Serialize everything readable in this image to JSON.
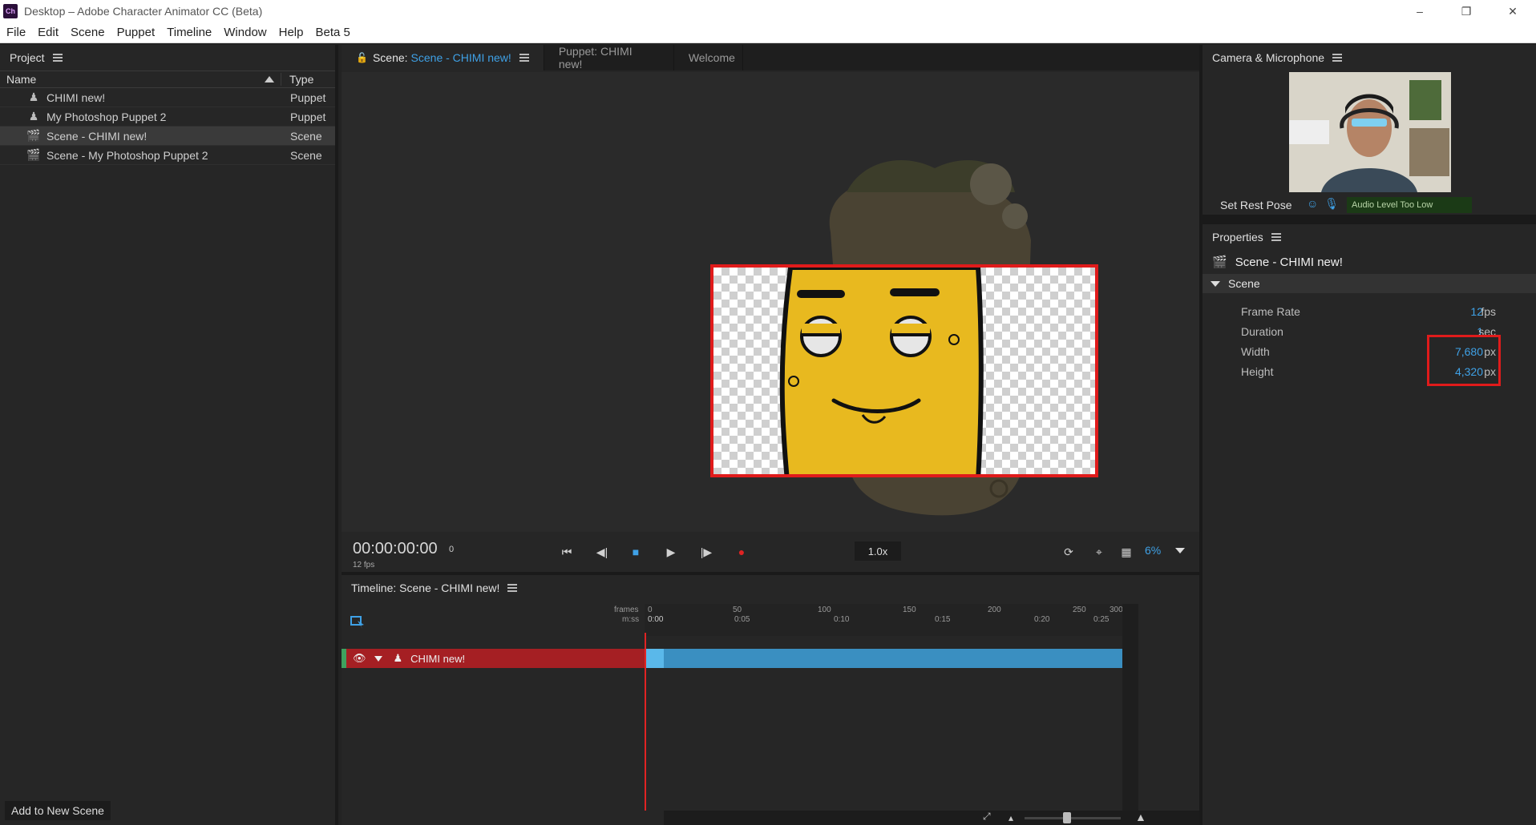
{
  "window": {
    "title": "Desktop – Adobe Character Animator CC (Beta)",
    "app_icon": "Ch",
    "controls": [
      "–",
      "❐",
      "✕"
    ]
  },
  "menu": [
    "File",
    "Edit",
    "Scene",
    "Puppet",
    "Timeline",
    "Window",
    "Help",
    "Beta 5"
  ],
  "project": {
    "title": "Project",
    "col_name": "Name",
    "col_type": "Type",
    "rows": [
      {
        "name": "CHIMI new!",
        "type": "Puppet",
        "icon": "puppet-icon"
      },
      {
        "name": "My Photoshop Puppet 2",
        "type": "Puppet",
        "icon": "puppet-icon"
      },
      {
        "name": "Scene - CHIMI new!",
        "type": "Scene",
        "icon": "scene-icon"
      },
      {
        "name": "Scene - My Photoshop Puppet 2",
        "type": "Scene",
        "icon": "scene-icon"
      }
    ],
    "add_button": "Add to New Scene"
  },
  "scene_panel": {
    "tab_scene_prefix": "Scene:",
    "tab_scene_name": "Scene - CHIMI new!",
    "tab_puppet": "Puppet: CHIMI new!",
    "tab_welcome": "Welcome",
    "timecode": "00:00:00:00",
    "frame": "0",
    "fps_label": "12 fps",
    "speed": "1.0x",
    "zoom": "6%"
  },
  "timeline": {
    "title": "Timeline: Scene - CHIMI new!",
    "frames_label": "frames",
    "mss_label": "m:ss",
    "frame_ticks": [
      "0",
      "50",
      "100",
      "150",
      "200",
      "250",
      "300"
    ],
    "time_ticks": [
      "0:00",
      "0:05",
      "0:10",
      "0:15",
      "0:20",
      "0:25"
    ],
    "track_name": "CHIMI new!"
  },
  "camera": {
    "title": "Camera & Microphone",
    "rest_pose": "Set Rest Pose",
    "audio_level": "Audio Level Too Low"
  },
  "properties": {
    "title": "Properties",
    "item": "Scene - CHIMI new!",
    "section": "Scene",
    "rows": [
      {
        "label": "Frame Rate",
        "value": "12",
        "unit": "fps"
      },
      {
        "label": "Duration",
        "value": "1",
        "unit": "sec"
      },
      {
        "label": "Width",
        "value": "7,680",
        "unit": "px"
      },
      {
        "label": "Height",
        "value": "4,320",
        "unit": "px"
      }
    ]
  },
  "colors": {
    "accent": "#3fa1e6",
    "record": "#e02323",
    "track": "#a51f23",
    "highlight": "#e01b1b",
    "character": "#e8b91f"
  }
}
